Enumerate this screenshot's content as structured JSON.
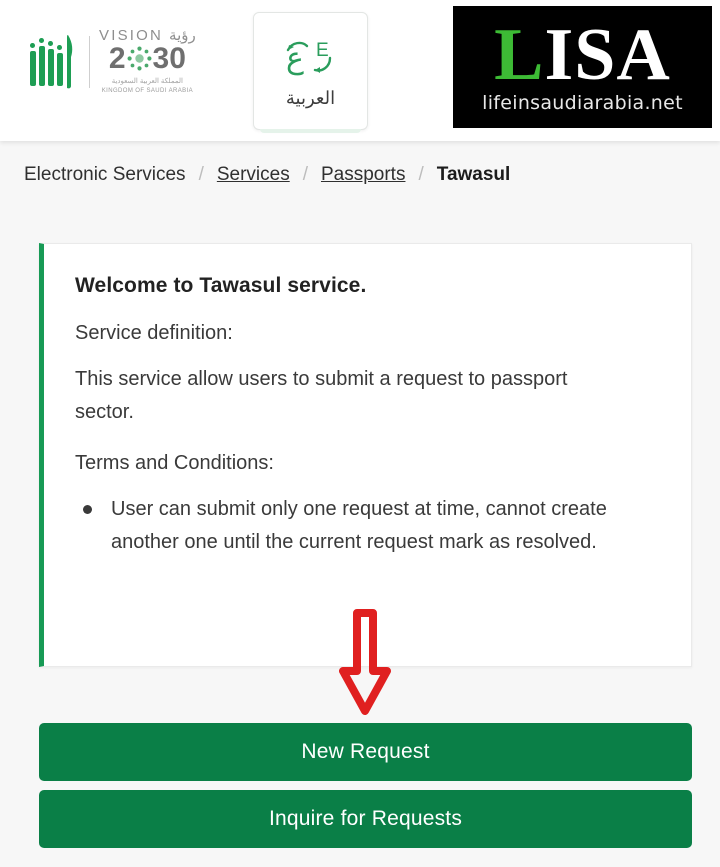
{
  "header": {
    "vision_logo": {
      "name": "vision-2030-logo",
      "word_en": "VISION",
      "word_ar": "رؤية",
      "year_prefix": "2",
      "year_suffix": "30",
      "kingdom_ar": "المملكة العربية السعودية",
      "kingdom_en": "KINGDOM OF SAUDI ARABIA"
    },
    "language_switch": {
      "icon": "language-swap-icon",
      "arabic_glyph": "ع",
      "english_glyph": "E",
      "label": "العربية"
    },
    "watermark": {
      "icon": "lisa-logo",
      "letter_first": "L",
      "letters_rest": "ISA",
      "url": "lifeinsaudiarabia.net"
    }
  },
  "breadcrumb": {
    "items": [
      {
        "label": "Electronic Services",
        "link": false,
        "current": false
      },
      {
        "label": "Services",
        "link": true,
        "current": false
      },
      {
        "label": "Passports",
        "link": true,
        "current": false
      },
      {
        "label": "Tawasul",
        "link": false,
        "current": true
      }
    ],
    "separator": "/"
  },
  "card": {
    "title": "Welcome to Tawasul service.",
    "definition_label": "Service definition:",
    "definition_text": "This service allow users to submit a request to passport sector.",
    "terms_label": "Terms and Conditions:",
    "terms": [
      "User can submit only one request at time, cannot create another one until the current request mark as resolved."
    ]
  },
  "annotation": {
    "arrow_icon": "down-arrow-icon",
    "color": "#e02020",
    "points_to": "New Request"
  },
  "actions": {
    "new_request_label": "New Request",
    "inquire_label": "Inquire for Requests"
  },
  "colors": {
    "primary_green": "#0a7f47",
    "accent_green": "#179a55",
    "logo_green": "#3dbb35",
    "page_background": "#f7f7f7",
    "annotation_red": "#e02020"
  }
}
